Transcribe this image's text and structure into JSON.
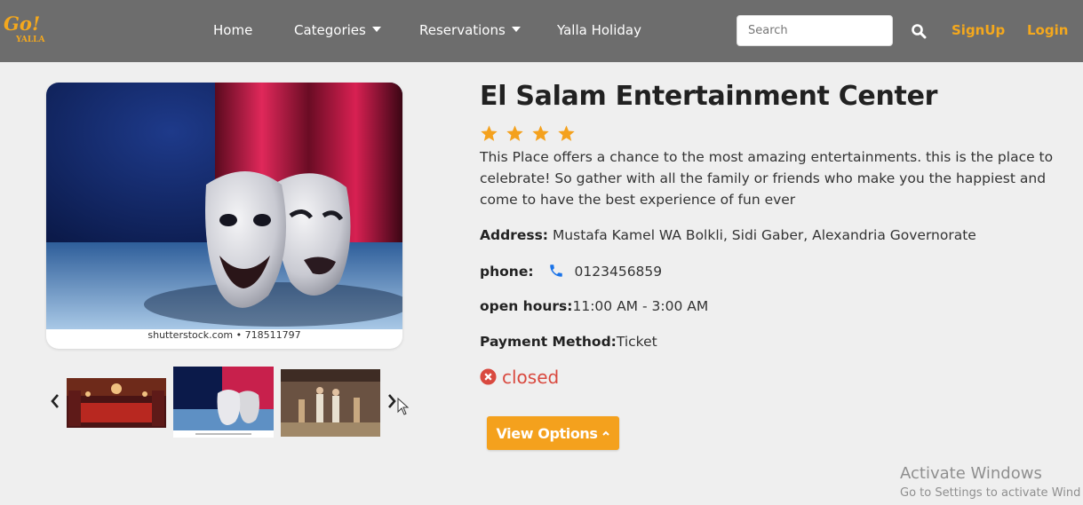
{
  "brand": {
    "logo_top": "Go!",
    "logo_bottom": "YALLA"
  },
  "nav": {
    "home": "Home",
    "categories": "Categories",
    "reservations": "Reservations",
    "holiday": "Yalla Holiday",
    "search_placeholder": "Search",
    "signup": "SignUp",
    "login": "Login"
  },
  "gallery": {
    "main_watermark": "shutterstock.com • 718511797",
    "thumbnails": [
      "theater hall",
      "theater masks",
      "stage performance"
    ],
    "selected_thumbnail": 2
  },
  "place": {
    "title": "El Salam Entertainment Center",
    "rating": 4,
    "description": "This Place offers a chance to the most amazing entertainments. this is the place to celebrate! So gather with all the family or friends who make you the happiest and come to have the best experience of fun ever",
    "address_label": "Address:",
    "address": "Mustafa Kamel WA Bolkli, Sidi Gaber, Alexandria Governorate",
    "phone_label": "phone:",
    "phone": "0123456859",
    "hours_label": "open hours:",
    "hours": "11:00 AM - 3:00 AM",
    "payment_label": "Payment Method:",
    "payment": "Ticket",
    "status": "closed"
  },
  "actions": {
    "view_options": "View Options"
  },
  "windows": {
    "line1": "Activate Windows",
    "line2": "Go to Settings to activate Wind"
  },
  "colors": {
    "accent": "#f4a11d",
    "navbar": "#6d6d6d",
    "closed": "#d9493f",
    "phone_icon": "#1a73e8",
    "background": "#efefef"
  }
}
